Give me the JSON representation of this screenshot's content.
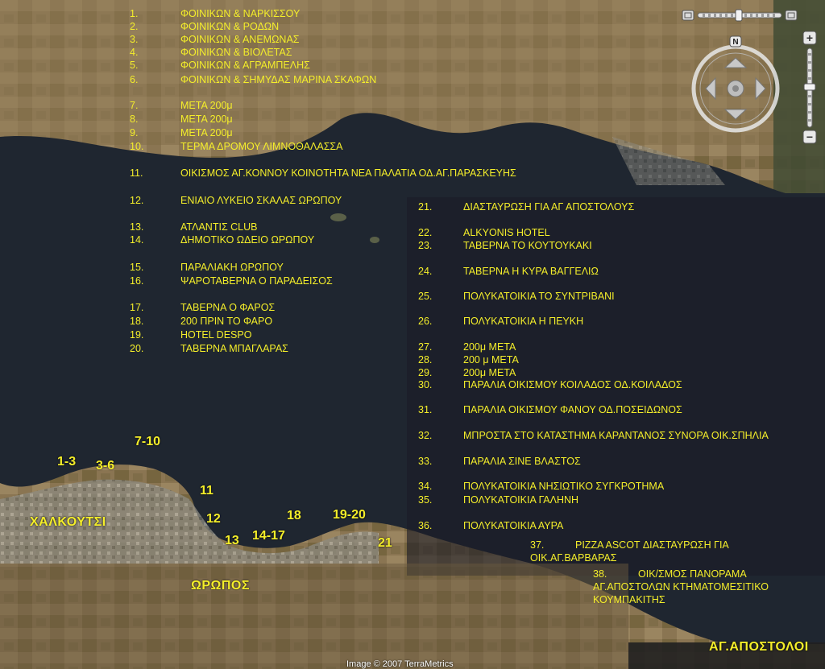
{
  "colors": {
    "label": "#f4ee2a",
    "sea": "#1f2630",
    "land": "#7b6a4a"
  },
  "legend": [
    {
      "num": "1.",
      "text": "ΦΟΙΝΙΚΩΝ & ΝΑΡΚΙΣΣΟΥ"
    },
    {
      "num": "2.",
      "text": "ΦΟΙΝΙΚΩΝ & ΡΟΔΩΝ"
    },
    {
      "num": "3.",
      "text": "ΦΟΙΝΙΚΩΝ & ΑΝΕΜΩΝΑΣ"
    },
    {
      "num": "4.",
      "text": "ΦΟΙΝΙΚΩΝ & ΒΙΟΛΕΤΑΣ"
    },
    {
      "num": "5.",
      "text": "ΦΟΙΝΙΚΩΝ & ΑΓΡΑΜΠΕΛΗΣ"
    },
    {
      "num": "6.",
      "text": "ΦΟΙΝΙΚΩΝ & ΣΗΜΥΔΑΣ ΜΑΡΙΝΑ ΣΚΑΦΩΝ"
    },
    {
      "num": "7.",
      "text": "ΜΕΤΑ 200μ"
    },
    {
      "num": "8.",
      "text": "ΜΕΤΑ 200μ"
    },
    {
      "num": "9.",
      "text": "ΜΕΤΑ 200μ"
    },
    {
      "num": "10.",
      "text": "ΤΕΡΜΑ ΔΡΟΜΟΥ ΛΙΜΝΟΘΑΛΑΣΣΑ"
    },
    {
      "num": "11.",
      "text": "ΟΙΚΙΣΜΟΣ ΑΓ.ΚΟΝΝΟΥ ΚΟΙΝΟΤΗΤΑ ΝΕΑ ΠΑΛΑΤΙΑ ΟΔ.ΑΓ.ΠΑΡΑΣΚΕΥΗΣ"
    },
    {
      "num": "12.",
      "text": "ΕΝΙΑΙΟ ΛΥΚΕΙΟ ΣΚΑΛΑΣ ΩΡΩΠΟΥ"
    },
    {
      "num": "13.",
      "text": "ΑΤΛΑΝΤΙΣ CLUB"
    },
    {
      "num": "14.",
      "text": "ΔΗΜΟΤΙΚΟ ΩΔΕΙΟ ΩΡΩΠΟΥ"
    },
    {
      "num": "15.",
      "text": "ΠΑΡΑΛΙΑΚΗ ΩΡΩΠΟΥ"
    },
    {
      "num": "16.",
      "text": "ΨΑΡΟΤΑΒΕΡΝΑ Ο ΠΑΡΑΔΕΙΣΟΣ"
    },
    {
      "num": "17.",
      "text": "ΤΑΒΕΡΝΑ Ο ΦΑΡΟΣ"
    },
    {
      "num": "18.",
      "text": "200 ΠΡΙΝ ΤΟ ΦΑΡΟ"
    },
    {
      "num": "19.",
      "text": "HOTEL DESPO"
    },
    {
      "num": "20.",
      "text": "ΤΑΒΕΡΝΑ ΜΠΑΓΛΑΡΑΣ"
    },
    {
      "num": "21.",
      "text": "ΔΙΑΣΤΑΥΡΩΣΗ ΓΙΑ ΑΓ ΑΠΟΣΤΟΛΟΥΣ"
    },
    {
      "num": "22.",
      "text": "ALKYONIS HOTEL"
    },
    {
      "num": "23.",
      "text": "ΤΑΒΕΡΝΑ ΤΟ ΚΟΥΤΟΥΚΑΚΙ"
    },
    {
      "num": "24.",
      "text": "ΤΑΒΕΡΝΑ Η ΚΥΡΑ ΒΑΓΓΕΛΙΩ"
    },
    {
      "num": "25.",
      "text": "ΠΟΛΥΚΑΤΟΙΚΙΑ ΤΟ ΣΥΝΤΡΙΒΑΝΙ"
    },
    {
      "num": "26.",
      "text": "ΠΟΛΥΚΑΤΟΙΚΙΑ Η ΠΕΥΚΗ"
    },
    {
      "num": "27.",
      "text": "200μ ΜΕΤΑ"
    },
    {
      "num": "28.",
      "text": "200 μ ΜΕΤΑ"
    },
    {
      "num": "29.",
      "text": "200μ ΜΕΤΑ"
    },
    {
      "num": "30.",
      "text": "ΠΑΡΑΛΙΑ ΟΙΚΙΣΜΟΥ ΚΟΙΛΑΔΟΣ ΟΔ.ΚΟΙΛΑΔΟΣ"
    },
    {
      "num": "31.",
      "text": "ΠΑΡΑΛΙΑ ΟΙΚΙΣΜΟΥ ΦΑΝΟΥ ΟΔ.ΠΟΣΕΙΔΩΝΟΣ"
    },
    {
      "num": "32.",
      "text": "ΜΠΡΟΣΤΑ ΣΤΟ ΚΑΤΑΣΤΗΜΑ ΚΑΡΑΝΤΑΝΟΣ ΣΥΝΟΡΑ ΟΙΚ.ΣΠΗΛΙΑ"
    },
    {
      "num": "33.",
      "text": "ΠΑΡΑΛΙΑ ΣΙΝΕ ΒΛΑΣΤΟΣ"
    },
    {
      "num": "34.",
      "text": "ΠΟΛΥΚΑΤΟΙΚΙΑ ΝΗΣΙΩΤΙΚΟ ΣΥΓΚΡΟΤΗΜΑ"
    },
    {
      "num": "35.",
      "text": "ΠΟΛΥΚΑΤΟΙΚΙΑ ΓΑΛΗΝΗ"
    },
    {
      "num": "36.",
      "text": "ΠΟΛΥΚΑΤΟΙΚΙΑ ΑΥΡΑ"
    },
    {
      "num": "37.",
      "text": "PIZZA ASCOT ΔΙΑΣΤΑΥΡΩΣΗ ΓΙΑ",
      "text2": "ΟΙΚ.ΑΓ.ΒΑΡΒΑΡΑΣ"
    },
    {
      "num": "38.",
      "text": "ΟΙΚ/ΣΜΟΣ ΠΑΝΟΡΑΜΑ",
      "text2": "ΑΓ.ΑΠΟΣΤΟΛΩΝ ΚΤΗΜΑΤΟΜΕΣΙΤΙΚΟ",
      "text3": "ΚΟΥΜΠΑΚΙΤΗΣ"
    }
  ],
  "markers": [
    "1-3",
    "3-6",
    "7-10",
    "11",
    "12",
    "13",
    "14-17",
    "18",
    "19-20",
    "21"
  ],
  "places": [
    "ΧΑΛΚΟΥΤΣΙ",
    "ΩΡΩΠΟΣ",
    "ΑΓ.ΑΠΟΣΤΟΛΟΙ"
  ],
  "controls": {
    "compass_north": "N",
    "zoom_in": "+",
    "zoom_out": "−"
  },
  "copyright": "Image © 2007 TerraMetrics"
}
